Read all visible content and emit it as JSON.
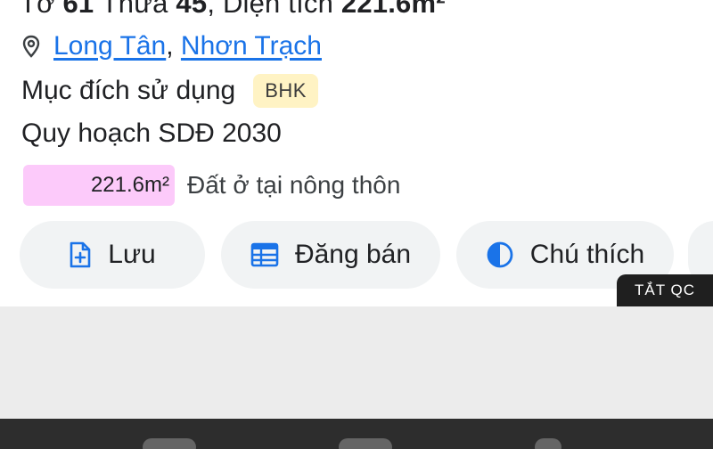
{
  "header": {
    "title_prefix": "Tờ ",
    "sheet_no": "61",
    "parcel_label": " Thửa ",
    "parcel_no": "45",
    "area_label": ", Diện tích ",
    "area_value": "221.6m²"
  },
  "location": {
    "icon": "location-pin-icon",
    "ward": "Long Tân",
    "separator": ",",
    "district": "Nhơn Trạch"
  },
  "purpose": {
    "label": "Mục đích sử dụng",
    "code": "BHK",
    "badge_color": "#fff3c4"
  },
  "plan": {
    "label": "Quy hoạch SDĐ 2030"
  },
  "zone": {
    "area": "221.6m²",
    "description": "Đất ở tại nông thôn",
    "color": "#fccafa"
  },
  "actions": {
    "save": {
      "label": "Lưu",
      "icon": "file-add-icon"
    },
    "sell": {
      "label": "Đăng bán",
      "icon": "calendar-table-icon"
    },
    "legend": {
      "label": "Chú thích",
      "icon": "contrast-icon"
    }
  },
  "ads": {
    "off_label": "TẮT QC"
  },
  "colors": {
    "link": "#1a73e8",
    "icon_blue": "#1a73e8",
    "button_bg": "#f1f3f4"
  }
}
